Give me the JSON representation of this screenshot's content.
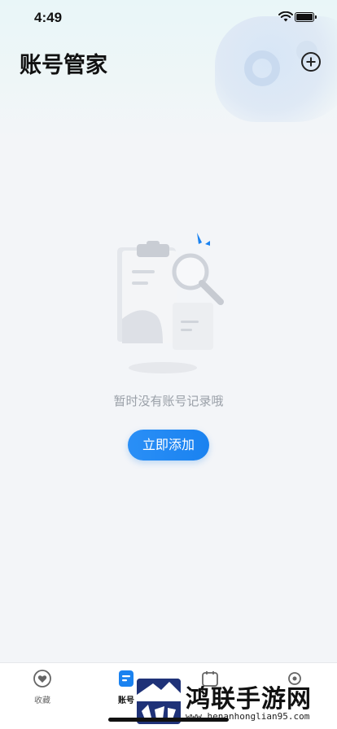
{
  "status_bar": {
    "time": "4:49"
  },
  "header": {
    "title": "账号管家"
  },
  "empty_state": {
    "message": "暂时没有账号记录哦",
    "button_label": "立即添加"
  },
  "tabbar": {
    "tabs": [
      {
        "label": "收藏",
        "icon": "heart-icon",
        "active": false
      },
      {
        "label": "账号",
        "icon": "document-icon",
        "active": true
      },
      {
        "label": "",
        "icon": "calendar-icon",
        "active": false
      },
      {
        "label": "",
        "icon": "gear-icon",
        "active": false
      }
    ]
  },
  "watermark": {
    "title": "鸿联手游网",
    "url": "www.henanhonglian95.com"
  },
  "colors": {
    "accent": "#1a82f0",
    "background": "#f3f5f8",
    "text_secondary": "#9aa0a8"
  }
}
